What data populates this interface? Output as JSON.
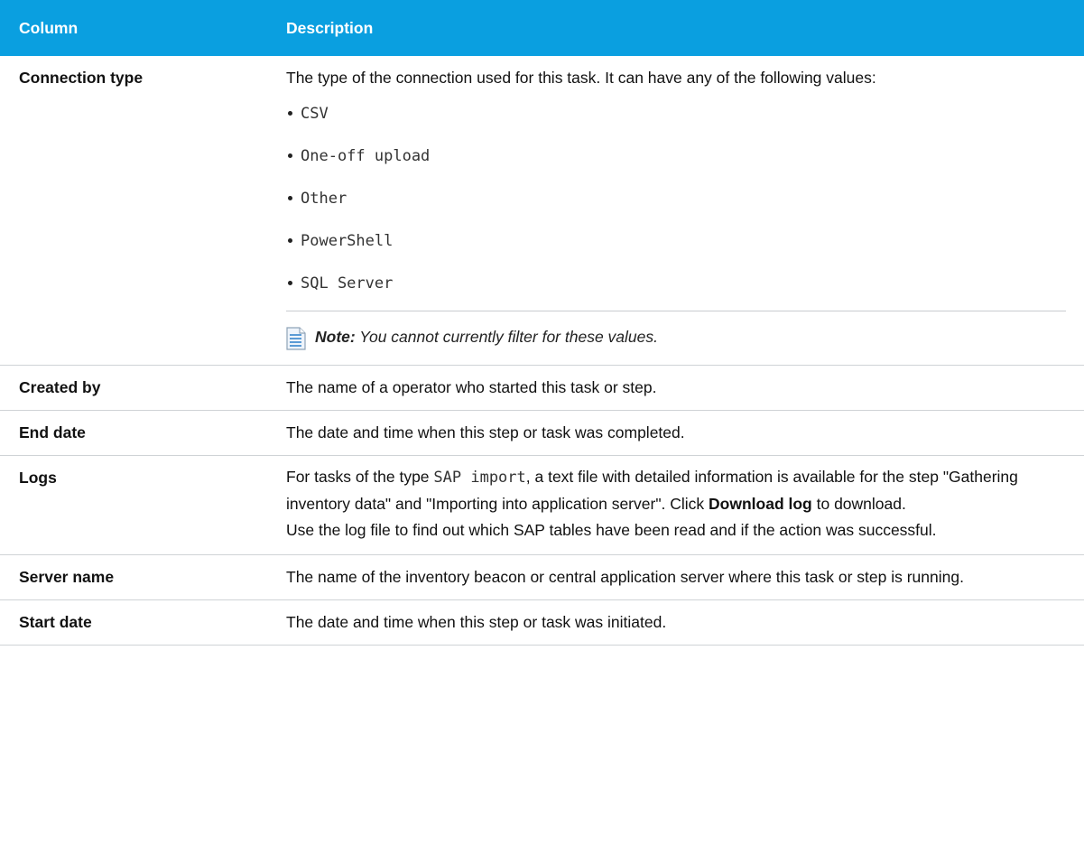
{
  "table": {
    "header": {
      "column": "Column",
      "description": "Description"
    },
    "connection_type": {
      "name": "Connection type",
      "intro": "The type of the connection used for this task. It can have any of the following values:",
      "values": [
        "CSV",
        "One-off upload",
        "Other",
        "PowerShell",
        "SQL Server"
      ],
      "note_label": "Note:",
      "note_text": " You cannot currently filter for these values."
    },
    "created_by": {
      "name": "Created by",
      "description": "The name of a operator who started this task or step."
    },
    "end_date": {
      "name": "End date",
      "description": "The date and time when this step or task was completed."
    },
    "logs": {
      "name": "Logs",
      "text_before_code": "For tasks of the type ",
      "code": "SAP import",
      "text_after_code": ", a text file with detailed information is available for the step \"Gathering inventory data\" and \"Importing into application server\". Click ",
      "link_label": "Download log",
      "text_after_link": " to download.",
      "second_paragraph": "Use the log file to find out which SAP tables have been read and if the action was successful."
    },
    "server_name": {
      "name": "Server name",
      "description": "The name of the inventory beacon or central application server where this task or step is running."
    },
    "start_date": {
      "name": "Start date",
      "description": "The date and time when this step or task was initiated."
    }
  },
  "icons": {
    "note": "note-document-icon"
  },
  "colors": {
    "header_bg": "#0a9fe0",
    "header_text": "#ffffff"
  }
}
